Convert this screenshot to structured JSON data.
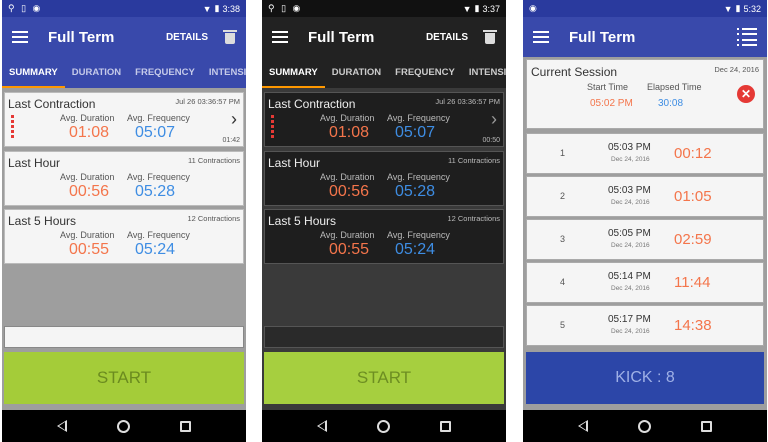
{
  "common": {
    "app_title": "Full Term",
    "details_label": "DETAILS",
    "start_label": "START",
    "tabs": [
      "SUMMARY",
      "DURATION",
      "FREQUENCY",
      "INTENSIT"
    ],
    "avg_duration_label": "Avg. Duration",
    "avg_frequency_label": "Avg. Frequency"
  },
  "phone_light": {
    "status_time": "3:38",
    "last_contraction": {
      "title": "Last Contraction",
      "timestamp": "Jul 26 03:36:57 PM",
      "duration": "01:08",
      "frequency": "05:07",
      "small_time": "01:42"
    },
    "last_hour": {
      "title": "Last Hour",
      "count": "11 Contractions",
      "duration": "00:56",
      "frequency": "05:28"
    },
    "last_5_hours": {
      "title": "Last 5 Hours",
      "count": "12 Contractions",
      "duration": "00:55",
      "frequency": "05:24"
    }
  },
  "phone_dark": {
    "status_time": "3:37",
    "last_contraction": {
      "title": "Last Contraction",
      "timestamp": "Jul 26 03:36:57 PM",
      "duration": "01:08",
      "frequency": "05:07",
      "small_time": "00:50"
    },
    "last_hour": {
      "title": "Last Hour",
      "count": "11 Contractions",
      "duration": "00:56",
      "frequency": "05:28"
    },
    "last_5_hours": {
      "title": "Last 5 Hours",
      "count": "12 Contractions",
      "duration": "00:55",
      "frequency": "05:24"
    }
  },
  "phone_kick": {
    "status_time": "5:32",
    "session": {
      "title": "Current Session",
      "date": "Dec 24, 2016",
      "start_label": "Start Time",
      "elapsed_label": "Elapsed Time",
      "start_value": "05:02 PM",
      "elapsed_value": "30:08"
    },
    "kicks": [
      {
        "num": "1",
        "time": "05:03 PM",
        "date": "Dec 24, 2016",
        "elapsed": "00:12"
      },
      {
        "num": "2",
        "time": "05:03 PM",
        "date": "Dec 24, 2016",
        "elapsed": "01:05"
      },
      {
        "num": "3",
        "time": "05:05 PM",
        "date": "Dec 24, 2016",
        "elapsed": "02:59"
      },
      {
        "num": "4",
        "time": "05:14 PM",
        "date": "Dec 24, 2016",
        "elapsed": "11:44"
      },
      {
        "num": "5",
        "time": "05:17 PM",
        "date": "Dec 24, 2016",
        "elapsed": "14:38"
      }
    ],
    "kick_button": "KICK : 8"
  },
  "colors": {
    "app_blue": "#3949ab",
    "tab_indicator": "#ff9800",
    "duration": "#f4754b",
    "frequency": "#3e8de3",
    "start_green": "#a4cc39",
    "kick_blue": "#2c46a8"
  },
  "icons": [
    "menu-icon",
    "trash-icon",
    "list-icon",
    "chevron-right-icon",
    "close-icon",
    "nav-back-icon",
    "nav-home-icon",
    "nav-recent-icon"
  ]
}
